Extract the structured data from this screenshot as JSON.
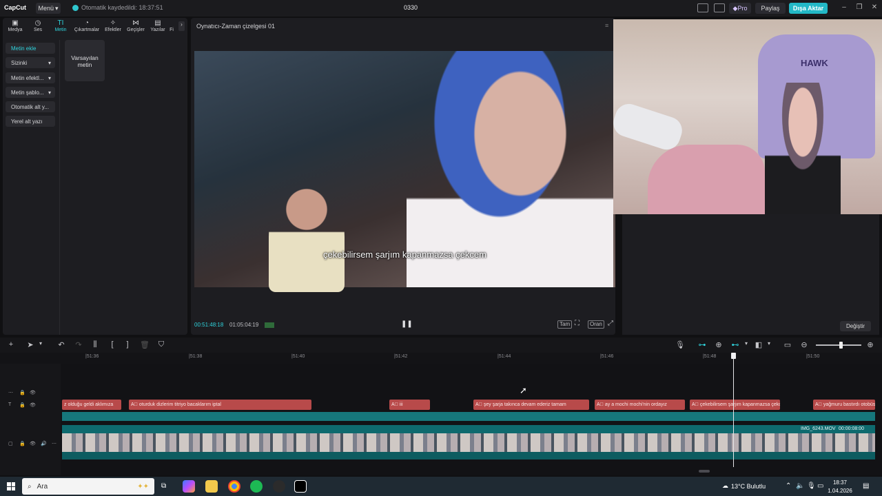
{
  "app": {
    "logo": "CapCut",
    "menu_label": "Menü",
    "autosave": "Otomatik kaydedildi: 18:37:51",
    "project_name": "0330",
    "pro_label": "Pro",
    "share_label": "Paylaş",
    "export_label": "Dışa Aktar"
  },
  "toolbar_tabs": [
    {
      "label": "Medya",
      "icon": "media-icon"
    },
    {
      "label": "Ses",
      "icon": "audio-icon"
    },
    {
      "label": "Metin",
      "icon": "text-icon",
      "active": true
    },
    {
      "label": "Çıkartmalar",
      "icon": "sticker-icon"
    },
    {
      "label": "Efektler",
      "icon": "effects-icon"
    },
    {
      "label": "Geçişler",
      "icon": "transitions-icon"
    },
    {
      "label": "Yazılar",
      "icon": "captions-icon"
    },
    {
      "label": "Fi",
      "icon": "filters-icon"
    }
  ],
  "side_menu": [
    {
      "label": "Metin ekle"
    },
    {
      "label": "Sizinki"
    },
    {
      "label": "Metin efektl..."
    },
    {
      "label": "Metin şablo..."
    },
    {
      "label": "Otomatik alt y..."
    },
    {
      "label": "Yerel alt yazı"
    }
  ],
  "preset_card": "Varsayılan metin",
  "player": {
    "title": "Oynatıcı-Zaman çizelgesi 01",
    "subtitle": "çekebilirsem şarjım kapanmazsa çekcem",
    "current_time": "00:51:48:18",
    "total_time": "01:05:04:19",
    "full_label": "Tam",
    "ratio_label": "Oran"
  },
  "webcam": {
    "chair_brand": "HAWK"
  },
  "right_panel": {
    "change_button": "Değiştir"
  },
  "ruler_ticks": [
    "|51:36",
    "|51:38",
    "|51:40",
    "|51:42",
    "|51:44",
    "|51:46",
    "|51:48",
    "|51:50"
  ],
  "text_clips": [
    {
      "text": "z olduğu geldi aklımıza"
    },
    {
      "text": "A⃞ oturduk dizlerim titriyo bacaklarım iptal"
    },
    {
      "text": "A⃞ iii"
    },
    {
      "text": "A⃞ şey şarja takınca devam ederiz tamam"
    },
    {
      "text": "A⃞ ay a mochi mochi'nin ordayız"
    },
    {
      "text": "A⃞ çekebilirsem şarjım kapanmazsa çekce"
    },
    {
      "text": "A⃞ yağmuru bastırdı otobüs"
    }
  ],
  "video_clip": {
    "name": "IMG_6243.MOV",
    "duration": "00:00:08:00"
  },
  "taskbar": {
    "search_placeholder": "Ara",
    "weather": "13°C Bulutlu",
    "time": "18:37",
    "date": "1.04.2026"
  },
  "colors": {
    "accent": "#2fd3dc",
    "export": "#23b8c6",
    "text_clip": "#b84a4a",
    "video_track": "#0e6a6e"
  }
}
